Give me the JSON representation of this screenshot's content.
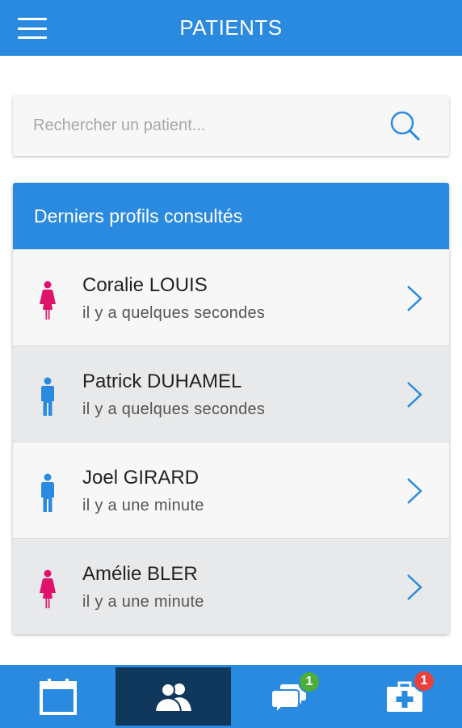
{
  "header": {
    "title": "PATIENTS",
    "menu_icon": "hamburger-menu-icon"
  },
  "search": {
    "placeholder": "Rechercher un patient...",
    "icon": "search-icon"
  },
  "recent": {
    "title": "Derniers profils consultés",
    "patients": [
      {
        "name": "Coralie LOUIS",
        "time": "il y a quelques secondes",
        "gender": "female"
      },
      {
        "name": "Patrick DUHAMEL",
        "time": "il y a quelques secondes",
        "gender": "male"
      },
      {
        "name": "Joel GIRARD",
        "time": "il y a une minute",
        "gender": "male"
      },
      {
        "name": "Amélie BLER",
        "time": "il y a une minute",
        "gender": "female"
      }
    ]
  },
  "bottom_nav": {
    "tabs": [
      {
        "icon": "calendar-icon",
        "active": false
      },
      {
        "icon": "patients-icon",
        "active": true
      },
      {
        "icon": "messages-icon",
        "active": false,
        "badge": "1"
      },
      {
        "icon": "medical-kit-icon",
        "active": false,
        "badge": "1"
      }
    ]
  },
  "colors": {
    "primary": "#2a8ae0",
    "active_tab": "#10375c",
    "female": "#e0136c",
    "male": "#2a8ae0",
    "badge_green": "#4cae3a",
    "badge_red": "#e8403a"
  }
}
